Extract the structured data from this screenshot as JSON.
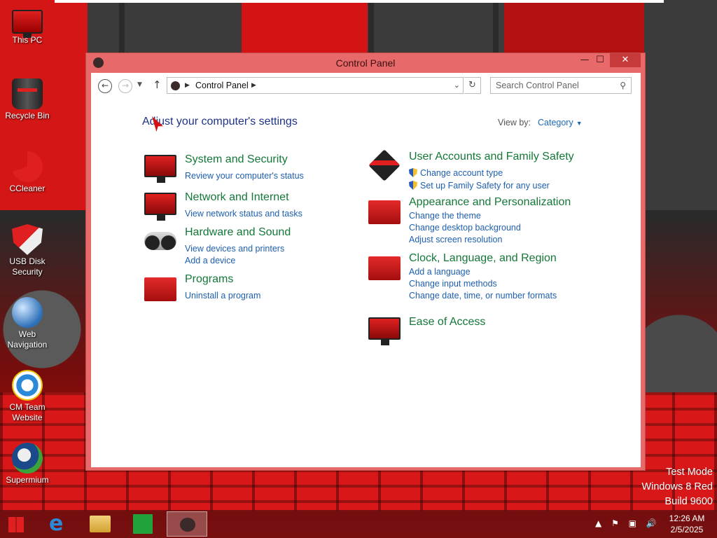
{
  "desktop": {
    "icons": [
      {
        "label": "This PC"
      },
      {
        "label": "Recycle Bin"
      },
      {
        "label": "CCleaner"
      },
      {
        "label": "USB Disk Security"
      },
      {
        "label": "Web Navigation"
      },
      {
        "label": "CM Team Website"
      },
      {
        "label": "Supermium"
      }
    ],
    "watermark": {
      "line1": "Test Mode",
      "line2": "Windows 8 Red",
      "line3": "Build 9600"
    }
  },
  "window": {
    "title": "Control Panel",
    "close_glyph": "✕",
    "minimize_glyph": "—",
    "maximize_glyph": "☐",
    "address": {
      "crumb": "Control Panel",
      "back_glyph": "←",
      "forward_glyph": "→",
      "up_glyph": "↑",
      "refresh_glyph": "↻"
    },
    "search": {
      "placeholder": "Search Control Panel"
    },
    "heading": "Adjust your computer's settings",
    "view_by": {
      "label": "View by:",
      "value": "Category"
    },
    "categories": [
      {
        "title": "System and Security",
        "links": [
          "Review your computer's status"
        ],
        "icon": "monitor-alert-icon"
      },
      {
        "title": "Network and Internet",
        "links": [
          "View network status and tasks"
        ],
        "icon": "network-globe-icon"
      },
      {
        "title": "Hardware and Sound",
        "links": [
          "View devices and printers",
          "Add a device"
        ],
        "icon": "gamepad-icon"
      },
      {
        "title": "Programs",
        "links": [
          "Uninstall a program"
        ],
        "icon": "programs-gear-icon"
      },
      {
        "title": "User Accounts and Family Safety",
        "links": [
          "Change account type",
          "Set up Family Safety for any user"
        ],
        "icon": "users-icon"
      },
      {
        "title": "Appearance and Personalization",
        "links": [
          "Change the theme",
          "Change desktop background",
          "Adjust screen resolution"
        ],
        "icon": "appearance-icon"
      },
      {
        "title": "Clock, Language, and Region",
        "links": [
          "Add a language",
          "Change input methods",
          "Change date, time, or number formats"
        ],
        "icon": "clock-icon"
      },
      {
        "title": "Ease of Access",
        "links": [],
        "icon": "ease-of-access-icon"
      }
    ]
  },
  "taskbar": {
    "clock_time": "12:26 AM",
    "clock_date": "2/5/2025",
    "items": [
      "start-icon",
      "internet-explorer-icon",
      "file-explorer-icon",
      "store-icon",
      "control-panel-icon"
    ]
  }
}
